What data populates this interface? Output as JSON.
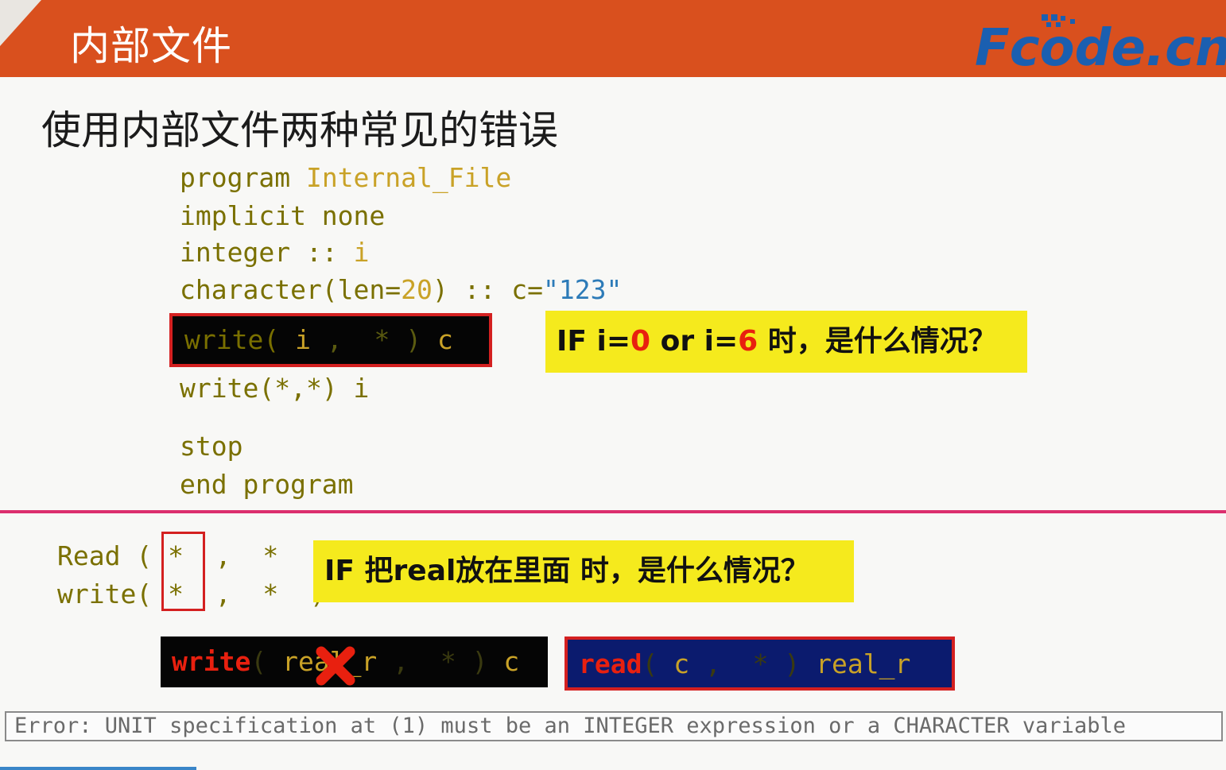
{
  "header": {
    "title": "内部文件",
    "logo_text": "Fcode.cn"
  },
  "subtitle": "使用内部文件两种常见的错误",
  "code_block": {
    "line1_kw": "program",
    "line1_name": "Internal_File",
    "line2": "implicit none",
    "line3_kw": "integer ::",
    "line3_var": "i",
    "line4_a": "character(len=",
    "line4_num": "20",
    "line4_b": ") :: c=",
    "line4_str": "\"123\"",
    "line5": "write(*,*) i",
    "line6": "stop",
    "line7": "end program"
  },
  "highlight1": {
    "write": "write",
    "paren_open": "(",
    "var": "i",
    "comma": ",",
    "star": "*",
    "paren_close": ")",
    "c": "c"
  },
  "callout1": {
    "prefix": "IF i=",
    "val1": "0",
    "mid": " or i=",
    "val2": "6",
    "suffix": " 时，是什么情况？"
  },
  "read_write": {
    "read_label": "Read",
    "write_label": "write",
    "open_paren": "(",
    "star_unit": "*",
    "comma": ",",
    "star_fmt": "*",
    "close_paren": ")"
  },
  "callout2": "IF 把real放在里面 时，是什么情况？",
  "bad_write": {
    "kw": "write",
    "open": "(",
    "var": "real_r",
    "comma": ",",
    "star": "*",
    "close": ")",
    "c": "c"
  },
  "bad_read": {
    "kw": "read",
    "open": "(",
    "c": "c",
    "comma": ",",
    "star": "*",
    "close": ")",
    "var": "real_r"
  },
  "error_message": "Error: UNIT specification at (1) must be an INTEGER expression or a CHARACTER variable",
  "colors": {
    "header_bg": "#d9501e",
    "callout_bg": "#f5ea1d",
    "divider": "#dc2f6e",
    "highlight_border": "#d42020",
    "logo_blue": "#1b5fb0"
  }
}
